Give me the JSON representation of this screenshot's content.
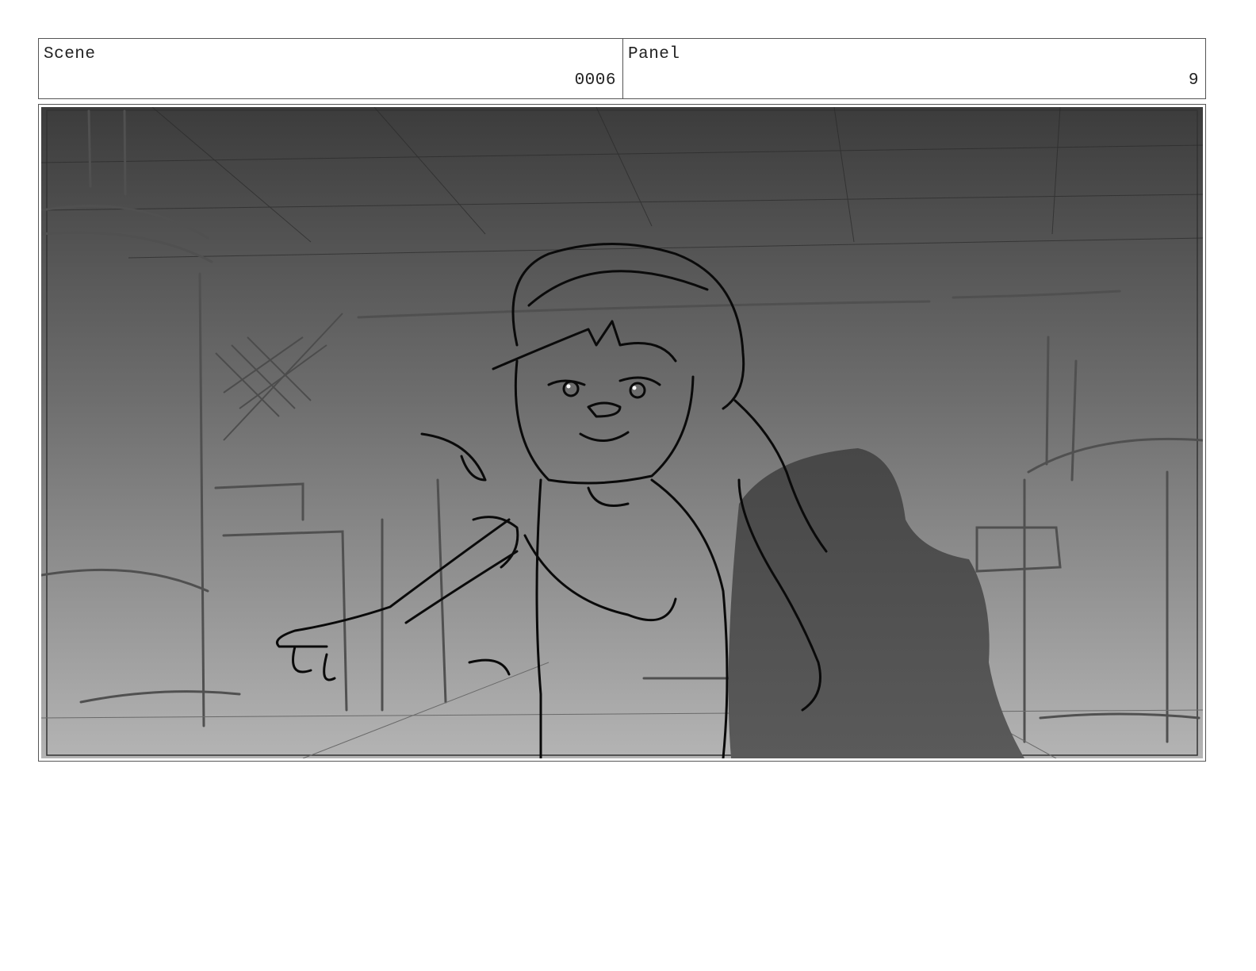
{
  "header": {
    "scene_label": "Scene",
    "scene_value": "0006",
    "panel_label": "Panel",
    "panel_value": "9"
  },
  "panel_image": {
    "icon": "storyboard-sketch-image"
  }
}
